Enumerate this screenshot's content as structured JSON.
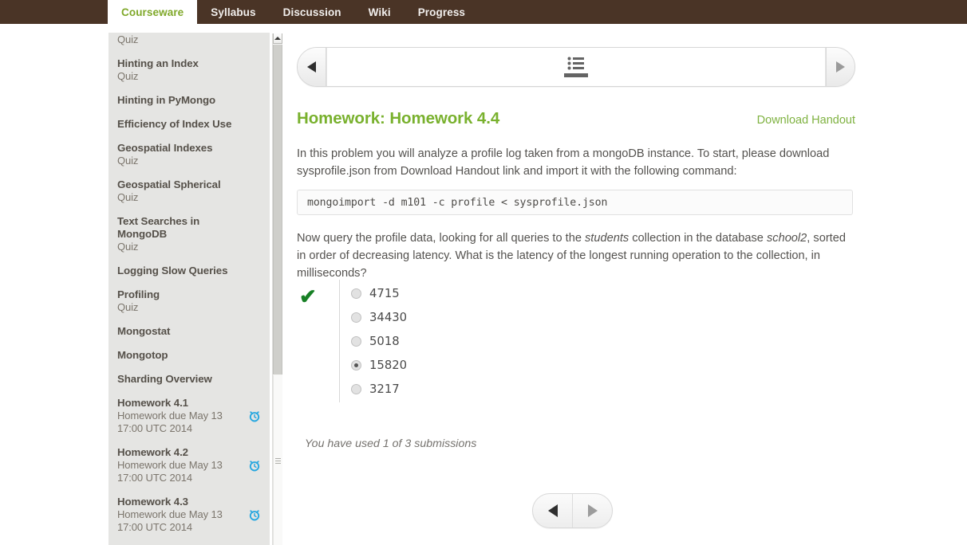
{
  "header": {
    "tabs": [
      {
        "label": "Courseware",
        "active": true
      },
      {
        "label": "Syllabus",
        "active": false
      },
      {
        "label": "Discussion",
        "active": false
      },
      {
        "label": "Wiki",
        "active": false
      },
      {
        "label": "Progress",
        "active": false
      }
    ],
    "bar_color": "#4a3426",
    "active_tab_color": "#7fa829"
  },
  "sidebar": {
    "items": [
      {
        "title": "",
        "sub": "Quiz",
        "due": null
      },
      {
        "title": "Hinting an Index",
        "sub": "Quiz",
        "due": null
      },
      {
        "title": "Hinting in PyMongo",
        "sub": "",
        "due": null
      },
      {
        "title": "Efficiency of Index Use",
        "sub": "",
        "due": null
      },
      {
        "title": "Geospatial Indexes",
        "sub": "Quiz",
        "due": null
      },
      {
        "title": "Geospatial Spherical",
        "sub": "Quiz",
        "due": null
      },
      {
        "title": "Text Searches in MongoDB",
        "sub": "Quiz",
        "due": null
      },
      {
        "title": "Logging Slow Queries",
        "sub": "",
        "due": null
      },
      {
        "title": "Profiling",
        "sub": "Quiz",
        "due": null
      },
      {
        "title": "Mongostat",
        "sub": "",
        "due": null
      },
      {
        "title": "Mongotop",
        "sub": "",
        "due": null
      },
      {
        "title": "Sharding Overview",
        "sub": "",
        "due": null
      },
      {
        "title": "Homework 4.1",
        "sub": "Homework due May 13 17:00 UTC 2014",
        "due": "alarm-clock-icon"
      },
      {
        "title": "Homework 4.2",
        "sub": "Homework due May 13 17:00 UTC 2014",
        "due": "alarm-clock-icon"
      },
      {
        "title": "Homework 4.3",
        "sub": "Homework due May 13 17:00 UTC 2014",
        "due": "alarm-clock-icon"
      }
    ],
    "clock_icon_color": "#29a8e0"
  },
  "sequence_nav": {
    "prev_icon": "triangle-left-icon",
    "next_icon": "triangle-right-icon",
    "items": [
      {
        "icon": "list-icon",
        "active": true
      }
    ]
  },
  "main": {
    "title": "Homework: Homework 4.4",
    "handout_link": "Download Handout",
    "paragraph_1_a": "In this problem you will analyze a profile log taken from a mongoDB instance. To start, please download sysprofile.json from Download Handout link and import it with the following command:",
    "code": "mongoimport -d m101 -c profile < sysprofile.json",
    "paragraph_2_a": "Now query the profile data, looking for all queries to the ",
    "paragraph_2_em1": "students",
    "paragraph_2_b": " collection in the database ",
    "paragraph_2_em2": "school2",
    "paragraph_2_c": ", sorted in order of decreasing latency. What is the latency of the longest running operation to the collection, in milliseconds?",
    "result_icon": "checkmark-icon",
    "result_color": "#178025",
    "choices": [
      {
        "label": "4715",
        "selected": false
      },
      {
        "label": "34430",
        "selected": false
      },
      {
        "label": "5018",
        "selected": false
      },
      {
        "label": "15820",
        "selected": true
      },
      {
        "label": "3217",
        "selected": false
      }
    ],
    "submissions_text": "You have used 1 of 3 submissions",
    "title_color": "#79b12e"
  },
  "bottom_nav": {
    "prev_icon": "triangle-left-icon",
    "next_icon": "triangle-right-icon"
  }
}
